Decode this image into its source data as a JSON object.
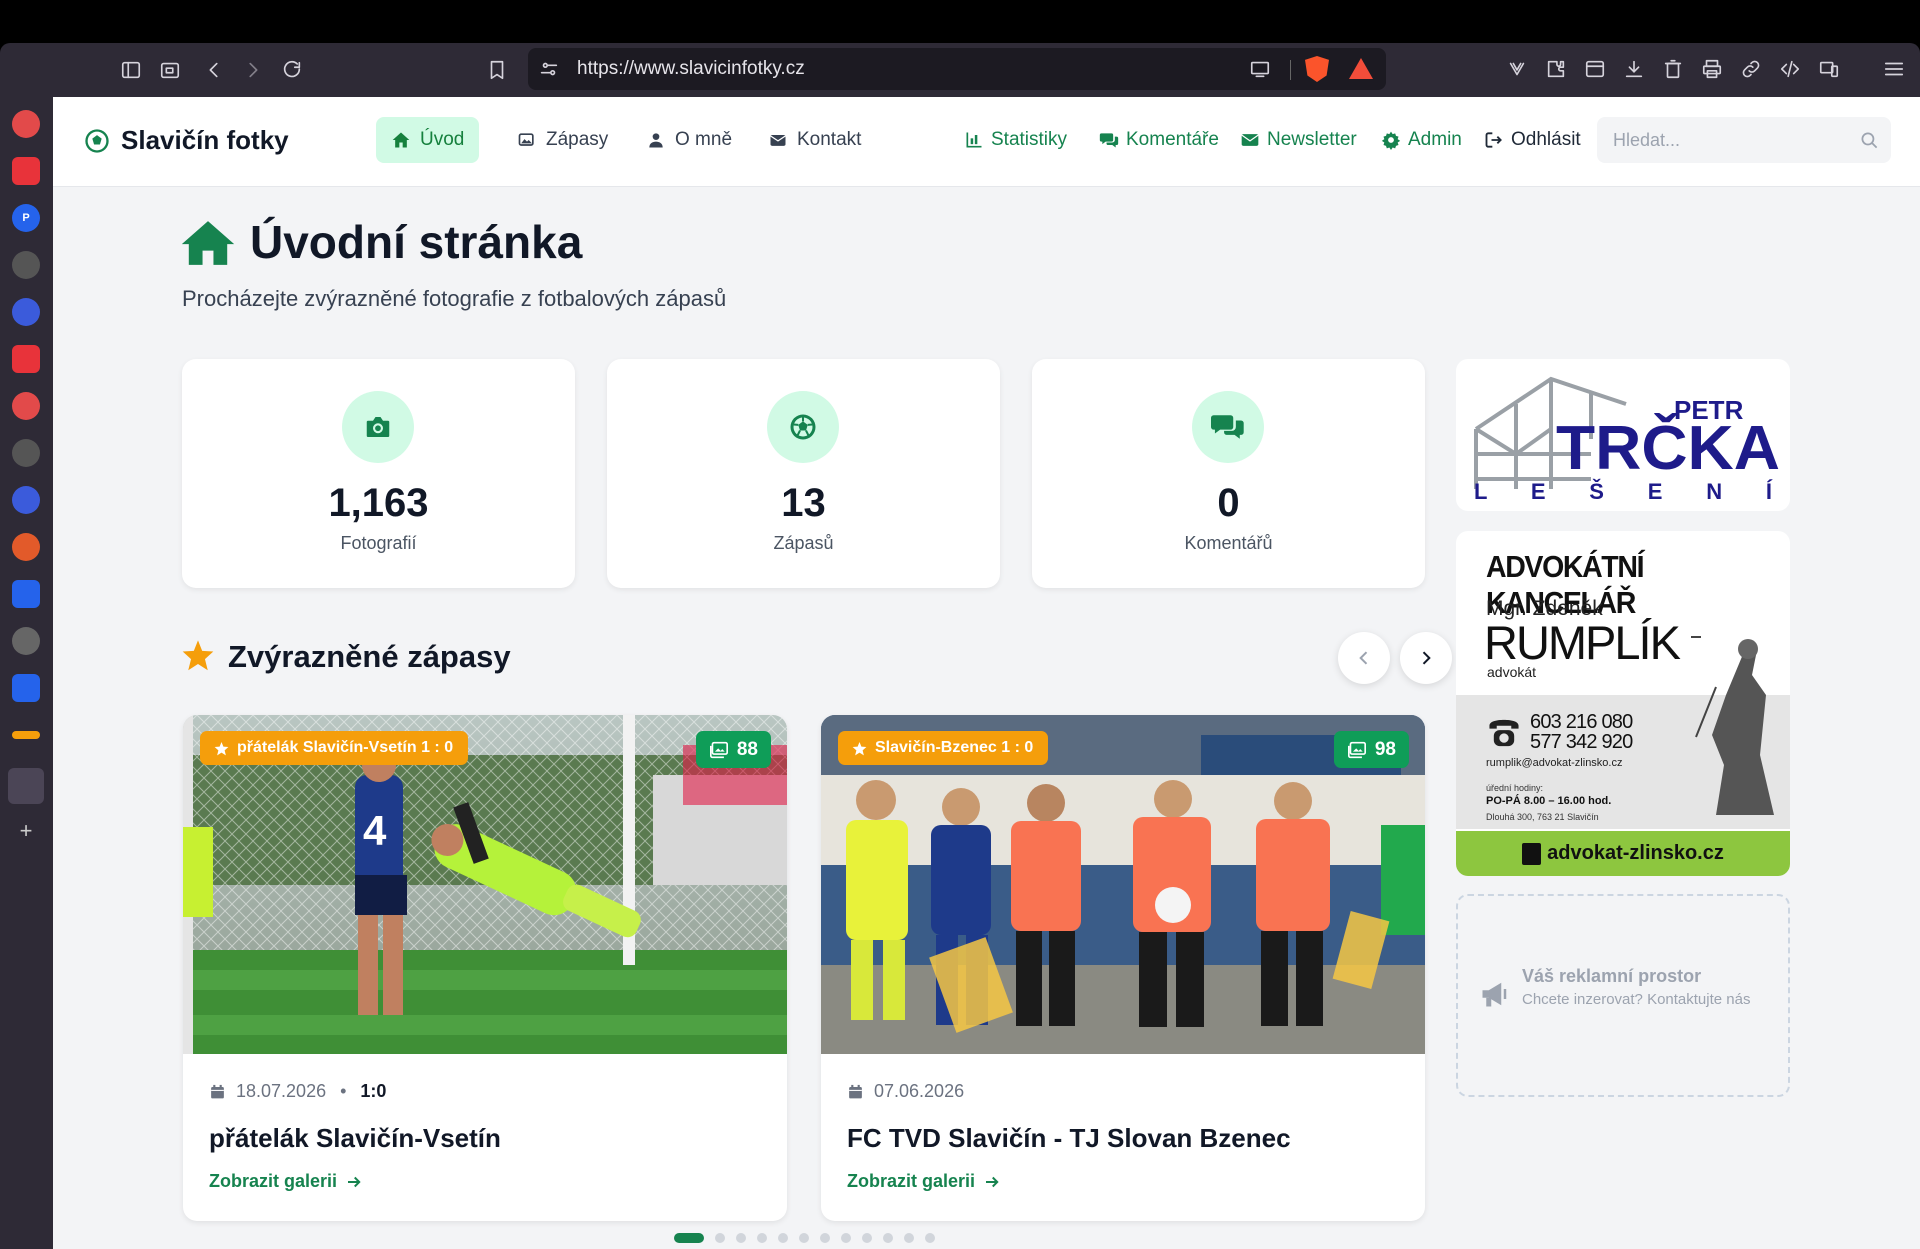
{
  "browser": {
    "url": "https://www.slavicinfotky.cz",
    "toolbar_left_icons": [
      "sidebar-toggle-icon",
      "tab-search-icon",
      "back-icon",
      "forward-icon",
      "reload-icon",
      "bookmark-icon"
    ],
    "url_right_icons": [
      "cast-icon",
      "brave-shields-icon",
      "brave-rewards-icon"
    ],
    "toolbar_right_icons": [
      "wallet-icon",
      "extensions-icon",
      "reading-list-icon",
      "download-icon",
      "trash-icon",
      "print-icon",
      "link-icon",
      "code-icon",
      "devices-icon",
      "menu-icon"
    ],
    "sidebar_icons": [
      "app-icon-1",
      "app-icon-2",
      "app-icon-3",
      "app-icon-4",
      "app-icon-5",
      "app-icon-6",
      "app-icon-7",
      "app-icon-8",
      "app-icon-9",
      "app-icon-10",
      "app-icon-11",
      "app-icon-12",
      "app-icon-13",
      "app-icon-14",
      "app-icon-15",
      "add-icon"
    ]
  },
  "site": {
    "brand": "Slavičín fotky",
    "nav": {
      "home": "Úvod",
      "matches": "Zápasy",
      "about": "O mně",
      "contact": "Kontakt",
      "stats": "Statistiky",
      "comments": "Komentáře",
      "newsletter": "Newsletter",
      "admin": "Admin",
      "logout": "Odhlásit"
    },
    "search": {
      "placeholder": "Hledat..."
    }
  },
  "hero": {
    "title": "Úvodní stránka",
    "subtitle": "Procházejte zvýrazněné fotografie z fotbalových zápasů"
  },
  "stats": [
    {
      "value": "1,163",
      "label": "Fotografií",
      "icon": "camera-icon"
    },
    {
      "value": "13",
      "label": "Zápasů",
      "icon": "football-icon"
    },
    {
      "value": "0",
      "label": "Komentářů",
      "icon": "comments-icon"
    }
  ],
  "featured": {
    "title": "Zvýrazněné zápasy",
    "matches": [
      {
        "badge": "přátelák Slavičín-Vsetín 1 : 0",
        "count": "88",
        "date": "18.07.2026",
        "score": "1:0",
        "title": "přátelák Slavičín-Vsetín",
        "link": "Zobrazit galerii"
      },
      {
        "badge": "Slavičín-Bzenec 1 : 0",
        "count": "98",
        "date": "07.06.2026",
        "score": "",
        "title": "FC TVD Slavičín - TJ Slovan Bzenec",
        "link": "Zobrazit galerii"
      }
    ],
    "dots_total": 12,
    "dots_active_index": 0,
    "meta_separator": "•"
  },
  "ads": {
    "trcka": {
      "name_top": "PETR",
      "name": "TRČKA",
      "sub": "L E Š E N Í"
    },
    "rumplik": {
      "head": "ADVOKÁTNÍ KANCELÁŘ",
      "person_first": "Mgr. Zdeněk",
      "person_last": "RUMPLÍK",
      "role": "advokát",
      "phone1": "603 216 080",
      "phone2": "577 342 920",
      "email": "rumplik@advokat-zlinsko.cz",
      "hours_label": "úřední hodiny:",
      "hours": "PO-PÁ 8.00 – 16.00 hod.",
      "address": "Dlouhá 300, 763 21 Slavičín",
      "domain": "advokat-zlinsko.cz"
    },
    "placeholder": {
      "title": "Váš reklamní prostor",
      "text": "Chcete inzerovat? Kontaktujte nás"
    }
  },
  "colors": {
    "accent": "#16834f",
    "accent_light": "#d1fae5",
    "badge_orange": "#f59e0b",
    "badge_green": "#0f9d58"
  }
}
